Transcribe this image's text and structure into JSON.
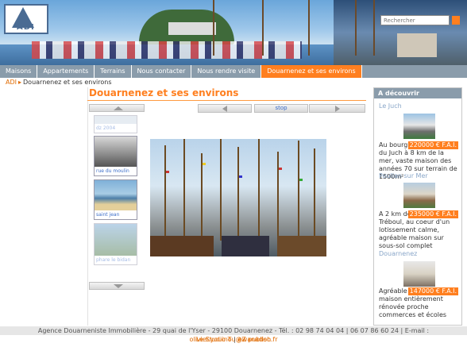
{
  "header": {
    "logo_text": "ADI",
    "search_placeholder": "Rechercher"
  },
  "nav": {
    "items": [
      "Maisons",
      "Appartements",
      "Terrains",
      "Nous contacter",
      "Nous rendre visite",
      "Douarnenez et ses environs"
    ],
    "active_index": 5
  },
  "breadcrumb": {
    "root": "ADI",
    "current": "Douarnenez et ses environs"
  },
  "main": {
    "title": "Douarnenez et ses environs",
    "slideshow": {
      "stop_label": "stop",
      "thumbnails": [
        {
          "caption": "dz 2004"
        },
        {
          "caption": "rue du moulin"
        },
        {
          "caption": "saint jean"
        },
        {
          "caption": "phare le bidan"
        }
      ]
    }
  },
  "sidebar": {
    "title": "A découvrir",
    "listings": [
      {
        "location": "Le Juch",
        "lead": "Au bourg",
        "price": "220000 € F.A.I.",
        "description": "du Juch à 8 km de la mer, vaste maison des années 70 sur terrain de 1500m²"
      },
      {
        "location": "Poullan sur Mer",
        "lead": "A 2 km de",
        "price": "235000 € F.A.I.",
        "description": "Tréboul, au coeur d'un lotissement calme, agréable maison sur sous-sol complet"
      },
      {
        "location": "Douarnenez",
        "lead": "Agréable",
        "price": "147000 € F.A.I.",
        "description": "maison entièrement rénovée proche commerces et écoles"
      }
    ]
  },
  "footer": {
    "address": "Agence Douarneniste Immobilière - 29 quai de l'Yser - 29100 Douarnenez - Tél. : 02 98 74 04 04 | 06 07 86 60 24 | E-mail :",
    "email": "olivier.youinou@wanadoo.fr",
    "credit_left": "Le Studio T",
    "credit_sep": "|",
    "credit_right": "eZ publish"
  },
  "colors": {
    "accent": "#ff7f1f",
    "nav_bg": "#8a9cab",
    "link": "#3a6cc8"
  }
}
